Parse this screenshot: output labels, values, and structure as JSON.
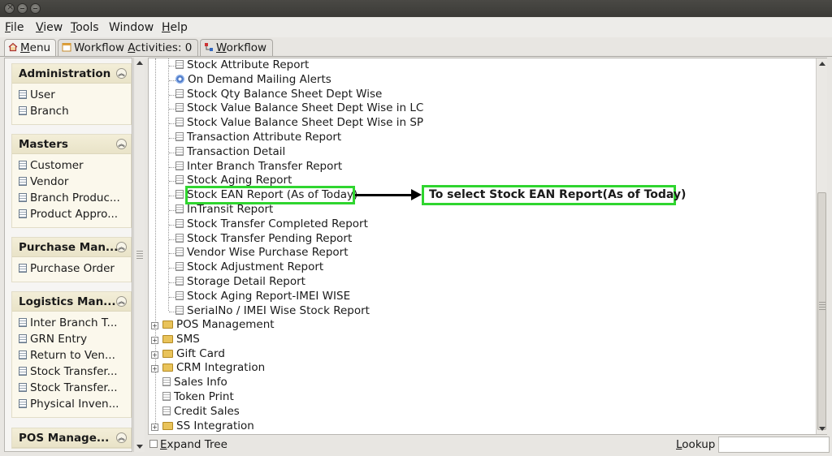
{
  "menubar": {
    "items": [
      {
        "first": "F",
        "rest": "ile"
      },
      {
        "first": "V",
        "rest": "iew"
      },
      {
        "first": "T",
        "rest": "ools"
      },
      {
        "first": "",
        "rest": "Window"
      },
      {
        "first": "H",
        "rest": "elp"
      }
    ]
  },
  "tabs": {
    "menu": {
      "first": "M",
      "rest": "enu"
    },
    "workflow_activities": {
      "pre": "Workflow ",
      "u": "A",
      "rest": "ctivities: 0"
    },
    "workflow": {
      "u": "W",
      "rest": "orkflow"
    }
  },
  "sidebar": {
    "groups": [
      {
        "title": "Administration",
        "items": [
          "User",
          "Branch"
        ]
      },
      {
        "title": "Masters",
        "items": [
          "Customer",
          "Vendor",
          "Branch Produc...",
          "Product Appro..."
        ]
      },
      {
        "title": "Purchase Man...",
        "items": [
          "Purchase Order"
        ]
      },
      {
        "title": "Logistics Man...",
        "items": [
          "Inter Branch T...",
          "GRN Entry",
          "Return to Ven...",
          "Stock Transfer...",
          "Stock Transfer...",
          "Physical Inven..."
        ]
      },
      {
        "title": "POS Manage...",
        "items": []
      }
    ]
  },
  "tree": {
    "report_items": [
      "Stock Attribute Report",
      "On Demand Mailing Alerts",
      "Stock Qty Balance Sheet Dept Wise",
      "Stock Value Balance Sheet Dept Wise in LC",
      "Stock Value Balance Sheet Dept Wise in SP",
      "Transaction Attribute Report",
      "Transaction Detail",
      "Inter Branch Transfer Report",
      "Stock Aging Report",
      "Stock EAN Report (As of Today)",
      "InTransit Report",
      "Stock Transfer Completed Report",
      "Stock Transfer Pending Report",
      "Vendor Wise Purchase Report",
      "Stock Adjustment Report",
      "Storage Detail Report",
      "Stock Aging Report-IMEI WISE",
      "SerialNo / IMEI Wise Stock Report"
    ],
    "top_items": [
      {
        "label": "POS Management",
        "kind": "folder"
      },
      {
        "label": "SMS",
        "kind": "folder"
      },
      {
        "label": "Gift Card",
        "kind": "folder"
      },
      {
        "label": "CRM Integration",
        "kind": "folder"
      },
      {
        "label": "Sales Info",
        "kind": "doc"
      },
      {
        "label": "Token Print",
        "kind": "doc"
      },
      {
        "label": "Credit Sales",
        "kind": "doc"
      },
      {
        "label": "SS Integration",
        "kind": "folder"
      }
    ],
    "selected_index": 9,
    "annotation": "To select Stock EAN Report(As of Today)"
  },
  "bottom": {
    "expand_label_first": "E",
    "expand_label_rest": "xpand Tree",
    "lookup_label_first": "L",
    "lookup_label_rest": "ookup",
    "lookup_value": ""
  },
  "colors": {
    "highlight": "#2fd52f",
    "window_bg": "#e8e6e2",
    "titlebar": "#3b3a36"
  }
}
